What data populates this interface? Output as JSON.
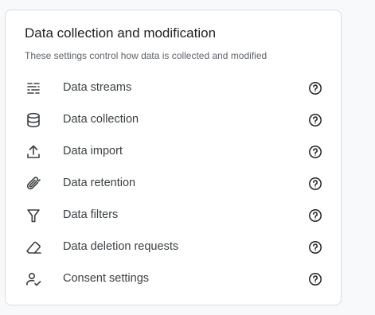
{
  "card": {
    "title": "Data collection and modification",
    "subtitle": "These settings control how data is collected and modified"
  },
  "items": [
    {
      "label": "Data streams",
      "icon": "data-streams-icon"
    },
    {
      "label": "Data collection",
      "icon": "database-icon"
    },
    {
      "label": "Data import",
      "icon": "upload-icon"
    },
    {
      "label": "Data retention",
      "icon": "paperclip-icon"
    },
    {
      "label": "Data filters",
      "icon": "filter-icon"
    },
    {
      "label": "Data deletion requests",
      "icon": "eraser-icon"
    },
    {
      "label": "Consent settings",
      "icon": "person-check-icon"
    }
  ],
  "help_icon": "help-circle-icon",
  "colors": {
    "text_primary": "#202124",
    "text_secondary": "#5f6368",
    "icon": "#3c4043",
    "border": "#dadce0",
    "background": "#f8f9fa"
  }
}
